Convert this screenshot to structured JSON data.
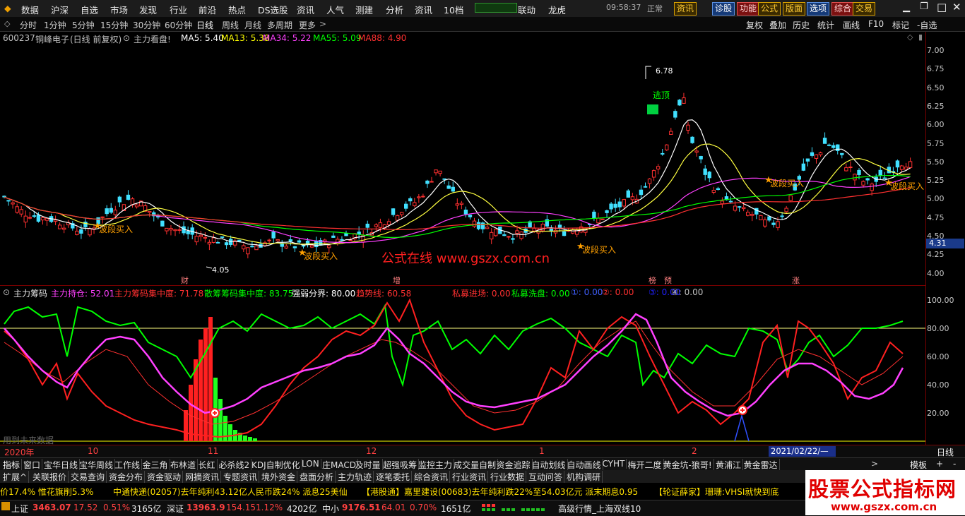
{
  "menu": [
    "数据",
    "沪深",
    "自选",
    "市场",
    "发现",
    "行业",
    "前沿",
    "热点",
    "DS选股",
    "资讯",
    "人气",
    "测建",
    "分析",
    "资讯",
    "10档"
  ],
  "menu_right": {
    "link": "联动",
    "logo": "龙虎",
    "time": "09:58:37",
    "status": "正常"
  },
  "top_buttons": [
    "资讯",
    "诊股",
    "功能",
    "公式",
    "版面",
    "选项",
    "综合",
    "交易"
  ],
  "periods": [
    "分时",
    "1分钟",
    "5分钟",
    "15分钟",
    "30分钟",
    "60分钟",
    "日线",
    "周线",
    "月线",
    "多周期",
    "更多"
  ],
  "period_active": "日线",
  "right_toolbar": [
    "复权",
    "叠加",
    "历史",
    "统计",
    "画线",
    "F10",
    "标记",
    "-自选"
  ],
  "stock": {
    "code": "600237",
    "name": "铜峰电子",
    "mode": "(日线 前复权)",
    "indicator": "主力看盘!"
  },
  "ma": [
    {
      "label": "MA5: 5.40",
      "color": "#ffffff"
    },
    {
      "label": "MA13: 5.38",
      "color": "#ffff00"
    },
    {
      "label": "MA34: 5.22",
      "color": "#ff40ff"
    },
    {
      "label": "MA55: 5.09",
      "color": "#00ff00"
    },
    {
      "label": "MA88: 4.90",
      "color": "#ff3030"
    }
  ],
  "price_axis": [
    "7.00",
    "6.75",
    "6.50",
    "6.25",
    "6.00",
    "5.75",
    "5.50",
    "5.25",
    "5.00",
    "4.75",
    "4.50",
    "4.25",
    "4.00"
  ],
  "current_price": "4.31",
  "annotations": {
    "high": "6.78",
    "low": "4.05",
    "escape": "逃顶",
    "buy": "波段买入",
    "watermark": "公式在线  www.gszx.com.cn"
  },
  "event_markers": [
    "财",
    "增",
    "榜",
    "预",
    "涨"
  ],
  "indicator_panel": {
    "name": "主力筹码",
    "items": [
      {
        "label": "主力持仓: 52.01",
        "color": "#ff40ff"
      },
      {
        "label": "主力筹码集中度: 71.78",
        "color": "#ff3030"
      },
      {
        "label": "散筹筹码集中度: 83.75",
        "color": "#00ff00"
      },
      {
        "label": "强弱分界: 80.00",
        "color": "#ffffff"
      },
      {
        "label": "趋势线: 60.58",
        "color": "#ff3030"
      },
      {
        "label": "私募进场: 0.00",
        "color": "#ff3030"
      },
      {
        "label": "私募洗盘: 0.00",
        "color": "#00ff00"
      },
      {
        "label": "①: 0.00",
        "color": "#4060ff"
      },
      {
        "label": "②: 0.00",
        "color": "#ff3030"
      },
      {
        "label": "③: 0.00",
        "color": "#2020ff"
      },
      {
        "label": "④: 0.00",
        "color": "#c0c0c0"
      }
    ],
    "axis": [
      "100.00",
      "80.00",
      "60.00",
      "40.00",
      "20.00"
    ],
    "note": "用到未来数据"
  },
  "time_axis": {
    "labels": [
      "2020年",
      "10",
      "11",
      "12",
      "1",
      "2"
    ],
    "cursor": "2021/02/22/—",
    "mode": "日线"
  },
  "indicator_tabs": [
    "指标",
    "窗口",
    "宝华日线",
    "宝华周线",
    "工作线",
    "金三角",
    "布林道",
    "长红",
    "必杀线2",
    "KDJ自制优化",
    "LON",
    "庄MACD",
    "及时量",
    "超强吸筹",
    "监控主力",
    "成交量自制",
    "资金追踪",
    "自动划线",
    "自动画线",
    "CYHT",
    "梅开二度",
    "黄金坑-狼哥!",
    "黄浦江",
    "黄金雷达"
  ],
  "tab_right": {
    "template": "模板",
    "plus": "+",
    "minus": "-"
  },
  "ext_tabs": [
    "扩展^",
    "关联报价",
    "交易查询",
    "资金分布",
    "资金驱动",
    "网摘资讯",
    "专题资讯",
    "境外资金",
    "盘面分析",
    "主力轨迹",
    "逐笔委托",
    "综合资讯",
    "行业资讯",
    "行业数据",
    "互动问答",
    "机构调研"
  ],
  "ticker": [
    "价17.4% 惟花旗削5.3%",
    "中通快递(02057)去年纯利43.12亿人民币跌24% 派息25美仙",
    "【港股通】嘉里建设(00683)去年纯利跌22%至54.03亿元 派末期息0.95",
    "【轮证薛家】珊珊:VHSI就快到底"
  ],
  "indexes": [
    {
      "name": "上证",
      "price": "3463.07",
      "chg": "17.52",
      "pct": "0.51%",
      "amt": "3165亿"
    },
    {
      "name": "深证",
      "price": "13963.9",
      "chg": "154.15",
      "pct": "1.12%",
      "amt": "4202亿"
    },
    {
      "name": "中小",
      "price": "9176.51",
      "chg": "64.01",
      "pct": "0.70%",
      "amt": "1651亿"
    }
  ],
  "status_text": "高级行情_上海双线10",
  "brand": {
    "title": "股票公式指标网",
    "url": "www.gszx.com.cn"
  }
}
